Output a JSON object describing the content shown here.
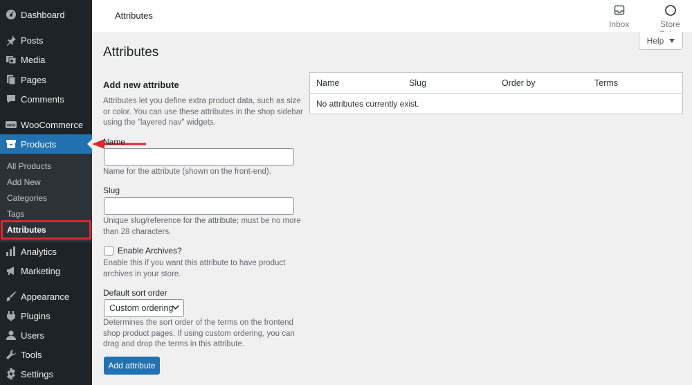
{
  "sidebar": {
    "items": [
      {
        "label": "Dashboard",
        "icon": "dashboard-icon"
      },
      {
        "label": "Posts",
        "icon": "pin-icon"
      },
      {
        "label": "Media",
        "icon": "media-icon"
      },
      {
        "label": "Pages",
        "icon": "pages-icon"
      },
      {
        "label": "Comments",
        "icon": "comment-icon"
      },
      {
        "label": "WooCommerce",
        "icon": "woo-icon"
      },
      {
        "label": "Products",
        "icon": "products-icon"
      },
      {
        "label": "Analytics",
        "icon": "bar-chart-icon"
      },
      {
        "label": "Marketing",
        "icon": "megaphone-icon"
      },
      {
        "label": "Appearance",
        "icon": "brush-icon"
      },
      {
        "label": "Plugins",
        "icon": "plugin-icon"
      },
      {
        "label": "Users",
        "icon": "user-icon"
      },
      {
        "label": "Tools",
        "icon": "wrench-icon"
      },
      {
        "label": "Settings",
        "icon": "settings-icon"
      }
    ],
    "submenu": [
      {
        "label": "All Products"
      },
      {
        "label": "Add New"
      },
      {
        "label": "Categories"
      },
      {
        "label": "Tags"
      },
      {
        "label": "Attributes"
      }
    ]
  },
  "topbar": {
    "title": "Attributes",
    "inbox_label": "Inbox",
    "store_setup_label": "Store Setup"
  },
  "help": {
    "label": "Help"
  },
  "page": {
    "title": "Attributes"
  },
  "form": {
    "heading": "Add new attribute",
    "intro": "Attributes let you define extra product data, such as size or color. You can use these attributes in the shop sidebar using the \"layered nav\" widgets.",
    "name_label": "Name",
    "name_value": "",
    "name_help": "Name for the attribute (shown on the front-end).",
    "slug_label": "Slug",
    "slug_value": "",
    "slug_help": "Unique slug/reference for the attribute; must be no more than 28 characters.",
    "archives_label": "Enable Archives?",
    "archives_checked": false,
    "archives_help": "Enable this if you want this attribute to have product archives in your store.",
    "sort_label": "Default sort order",
    "sort_value": "Custom ordering",
    "sort_help": "Determines the sort order of the terms on the frontend shop product pages. If using custom ordering, you can drag and drop the terms in this attribute.",
    "submit_label": "Add attribute"
  },
  "table": {
    "columns": [
      "Name",
      "Slug",
      "Order by",
      "Terms"
    ],
    "empty_message": "No attributes currently exist."
  },
  "colors": {
    "sidebar_bg": "#1d2327",
    "accent": "#2271b1",
    "annotation_red": "#e0262d"
  }
}
